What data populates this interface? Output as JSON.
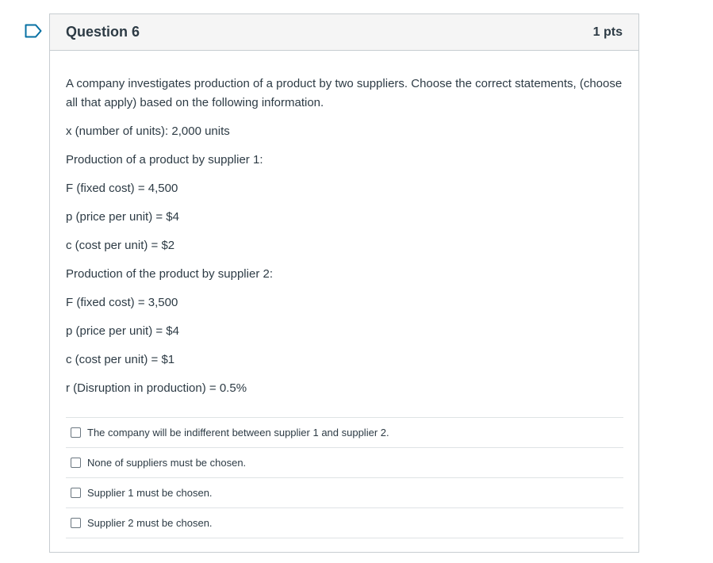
{
  "question": {
    "title": "Question 6",
    "points": "1 pts"
  },
  "body": {
    "paragraphs": [
      "A company investigates production of a product by two suppliers. Choose the correct statements, (choose all that apply) based on the following information.",
      "x (number of units): 2,000 units",
      "Production of a product by supplier 1:",
      "F (fixed cost) = 4,500",
      "p (price per unit) = $4",
      "c (cost per unit) = $2",
      "Production of the product by supplier 2:",
      "F (fixed cost) = 3,500",
      "p (price per unit) = $4",
      "c (cost per unit) = $1",
      "r (Disruption in production) = 0.5%"
    ]
  },
  "answers": [
    {
      "label": "The company will be indifferent between supplier 1 and supplier 2.",
      "checked": false
    },
    {
      "label": "None of suppliers must be chosen.",
      "checked": false
    },
    {
      "label": "Supplier 1 must be chosen.",
      "checked": false
    },
    {
      "label": "Supplier 2 must be chosen.",
      "checked": false
    }
  ],
  "colors": {
    "flag": "#0770a3",
    "header_bg": "#f5f5f5",
    "border": "#c7cdd1",
    "text": "#2d3b45"
  },
  "icons": {
    "flag": "bookmark-flag-icon"
  }
}
